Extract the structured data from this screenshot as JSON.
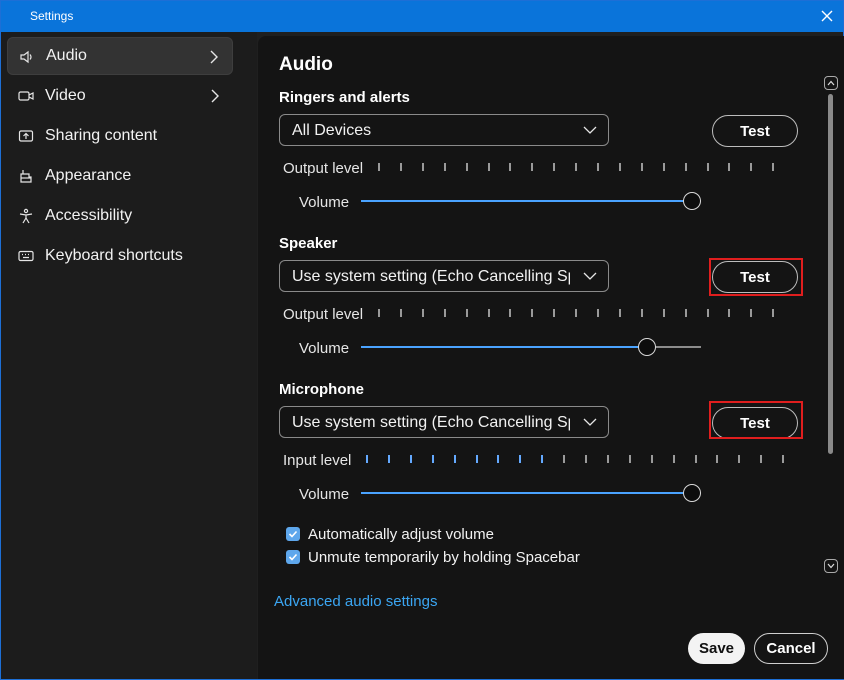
{
  "window": {
    "title": "Settings"
  },
  "sidebar": {
    "items": [
      {
        "label": "Audio",
        "icon": "speaker-icon",
        "active": true,
        "has_chevron": true
      },
      {
        "label": "Video",
        "icon": "video-camera-icon",
        "active": false,
        "has_chevron": true
      },
      {
        "label": "Sharing content",
        "icon": "share-screen-icon",
        "active": false,
        "has_chevron": false
      },
      {
        "label": "Appearance",
        "icon": "paint-bucket-icon",
        "active": false,
        "has_chevron": false
      },
      {
        "label": "Accessibility",
        "icon": "accessibility-icon",
        "active": false,
        "has_chevron": false
      },
      {
        "label": "Keyboard shortcuts",
        "icon": "keyboard-icon",
        "active": false,
        "has_chevron": false
      }
    ]
  },
  "main": {
    "title": "Audio",
    "ringers": {
      "heading": "Ringers and alerts",
      "device": "All Devices",
      "test_label": "Test",
      "output_label": "Output level",
      "volume_label": "Volume",
      "volume_value": 1.0
    },
    "speaker": {
      "heading": "Speaker",
      "device": "Use system setting (Echo Cancelling Speakerphone)",
      "test_label": "Test",
      "output_label": "Output level",
      "volume_label": "Volume",
      "volume_value": 0.84
    },
    "microphone": {
      "heading": "Microphone",
      "device": "Use system setting (Echo Cancelling Speakerphone)",
      "test_label": "Test",
      "input_label": "Input level",
      "input_level_active_ticks": 9,
      "volume_label": "Volume",
      "volume_value": 1.0
    },
    "checks": [
      {
        "label": "Automatically adjust volume",
        "checked": true
      },
      {
        "label": "Unmute temporarily by holding Spacebar",
        "checked": true
      }
    ],
    "advanced_link": "Advanced audio settings",
    "save_label": "Save",
    "cancel_label": "Cancel"
  },
  "colors": {
    "titlebar": "#0a74da",
    "accent": "#4aa3ff",
    "link": "#3ba6f3",
    "highlight_box": "#e01e1e"
  }
}
